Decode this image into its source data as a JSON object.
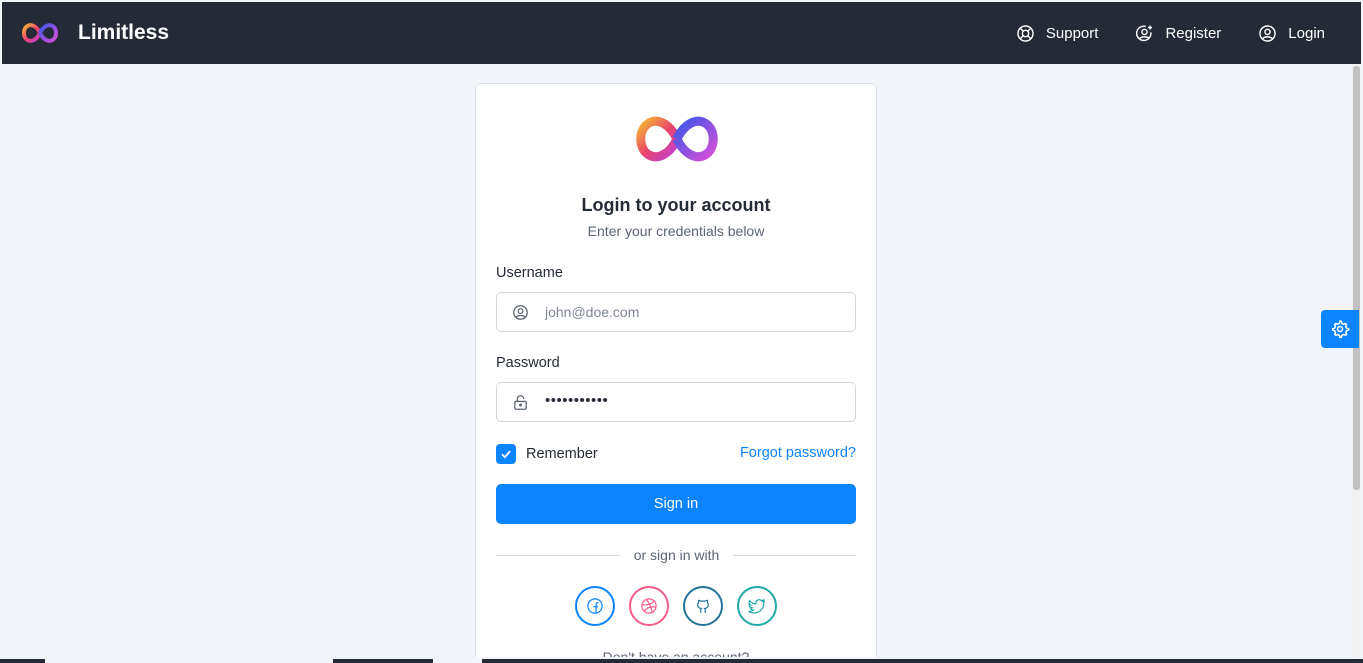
{
  "navbar": {
    "brand_name": "Limitless",
    "links": [
      {
        "label": "Support",
        "icon": "lifebuoy-icon"
      },
      {
        "label": "Register",
        "icon": "user-plus-icon"
      },
      {
        "label": "Login",
        "icon": "user-circle-icon"
      }
    ]
  },
  "login": {
    "title": "Login to your account",
    "subtitle": "Enter your credentials below",
    "username_label": "Username",
    "username_placeholder": "john@doe.com",
    "password_label": "Password",
    "password_value": "•••••••••••",
    "remember_label": "Remember",
    "remember_checked": true,
    "forgot_label": "Forgot password?",
    "signin_label": "Sign in",
    "divider_text": "or sign in with",
    "social": [
      "facebook-icon",
      "dribbble-icon",
      "github-icon",
      "twitter-icon"
    ],
    "no_account_text": "Don't have an account?"
  },
  "colors": {
    "navbar_bg": "#252b36",
    "accent": "#0c83ff",
    "page_bg": "#f1f4f9"
  }
}
